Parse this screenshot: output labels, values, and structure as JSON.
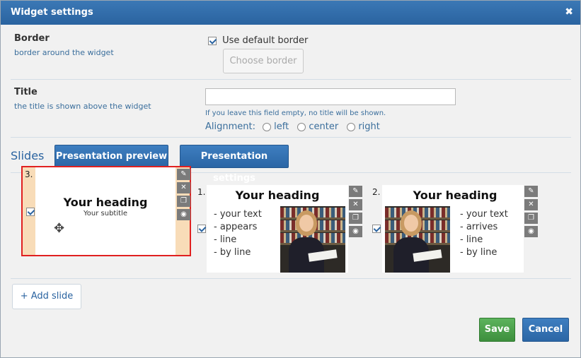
{
  "dialog": {
    "title": "Widget settings",
    "close_icon": "close-icon"
  },
  "border": {
    "title": "Border",
    "desc": "border around the widget",
    "use_default_label": "Use default border",
    "use_default_checked": true,
    "choose_button": "Choose border"
  },
  "title_section": {
    "title": "Title",
    "desc": "the title is shown above the widget",
    "input_value": "",
    "hint": "If you leave this field empty, no title will be shown.",
    "alignment_label": "Alignment:",
    "options": [
      "left",
      "center",
      "right"
    ]
  },
  "slides": {
    "label": "Slides",
    "preview_button": "Presentation preview",
    "settings_button": "Presentation settings",
    "items": [
      {
        "num": "3.",
        "heading": "Your heading",
        "subtitle": "Your subtitle",
        "checked": true
      },
      {
        "num": "1.",
        "heading": "Your heading",
        "bullets": [
          "- your text",
          "- appears",
          "- line",
          "- by line"
        ],
        "checked": true
      },
      {
        "num": "2.",
        "heading": "Your heading",
        "bullets": [
          "- your text",
          "- arrives",
          "- line",
          "- by line"
        ],
        "checked": true
      }
    ],
    "add_button": "+ Add slide"
  },
  "footer": {
    "save": "Save",
    "cancel": "Cancel"
  },
  "colors": {
    "accent": "#2a63a0",
    "save": "#4aa34a",
    "selected_border": "#e02020",
    "selected_bg": "#f8dcb8"
  }
}
